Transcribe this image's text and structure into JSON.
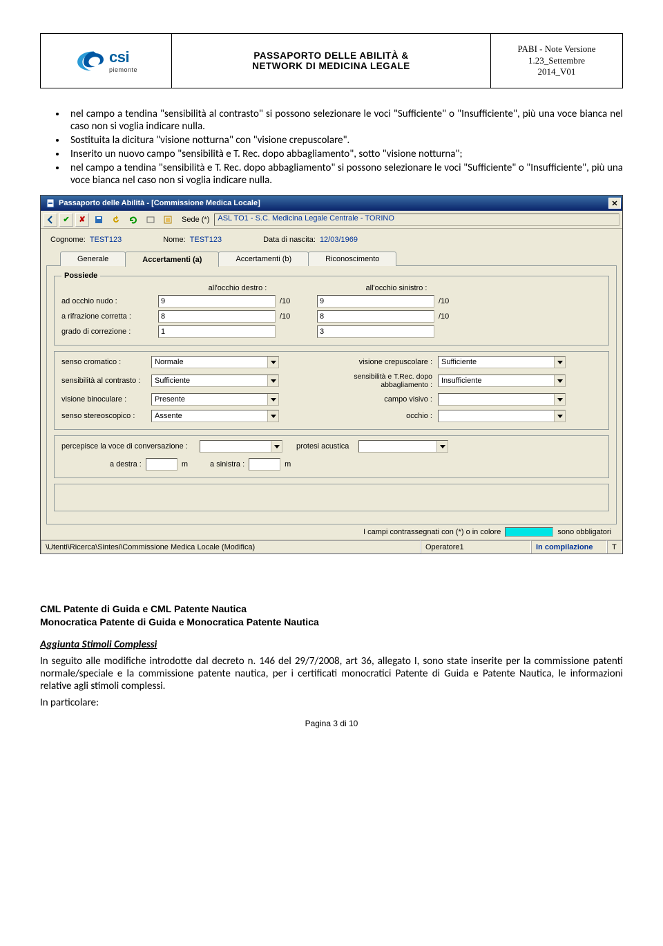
{
  "header": {
    "logo_main": "csi",
    "logo_sub": "piemonte",
    "title_line1": "PASSAPORTO DELLE ABILITÀ &",
    "title_line2": "NETWORK DI MEDICINA LEGALE",
    "meta_line1": "PABI - Note Versione",
    "meta_line2": "1.23_Settembre",
    "meta_line3": "2014_V01"
  },
  "bullets": [
    "nel campo a tendina \"sensibilità al contrasto\" si possono selezionare le voci \"Sufficiente\" o \"Insufficiente\", più una voce bianca nel caso non si voglia indicare nulla.",
    "Sostituita la dicitura \"visione notturna\" con \"visione crepuscolare\".",
    "Inserito un nuovo campo \"sensibilità e T. Rec. dopo abbagliamento\", sotto \"visione notturna\";",
    "nel campo a tendina \"sensibilità e T. Rec. dopo abbagliamento\" si possono selezionare le voci \"Sufficiente\" o \"Insufficiente\", più una voce bianca nel caso non si voglia indicare nulla."
  ],
  "window": {
    "title": "Passaporto delle Abilità - [Commissione Medica Locale]",
    "sede_label": "Sede (*)",
    "sede_value": "ASL TO1 - S.C. Medicina Legale Centrale - TORINO",
    "cognome_label": "Cognome:",
    "cognome_value": "TEST123",
    "nome_label": "Nome:",
    "nome_value": "TEST123",
    "dob_label": "Data di nascita:",
    "dob_value": "12/03/1969",
    "tabs": [
      "Generale",
      "Accertamenti (a)",
      "Accertamenti (b)",
      "Riconoscimento"
    ],
    "possiede_label": "Possiede",
    "col_dx": "all'occhio destro :",
    "col_sx": "all'occhio sinistro :",
    "rows": {
      "nudo_label": "ad occhio nudo :",
      "nudo_dx": "9",
      "nudo_sx": "9",
      "rifr_label": "a rifrazione corretta :",
      "rifr_dx": "8",
      "rifr_sx": "8",
      "grado_label": "grado di correzione :",
      "grado_dx": "1",
      "grado_sx": "3",
      "suffix10": "/10"
    },
    "senso_cromatico_label": "senso cromatico :",
    "senso_cromatico_value": "Normale",
    "sens_contrasto_label": "sensibilità al contrasto :",
    "sens_contrasto_value": "Sufficiente",
    "visione_binoc_label": "visione binoculare :",
    "visione_binoc_value": "Presente",
    "senso_stereo_label": "senso stereoscopico :",
    "senso_stereo_value": "Assente",
    "vis_crep_label": "visione crepuscolare :",
    "vis_crep_value": "Sufficiente",
    "sens_abbag_label": "sensibilità e T.Rec. dopo abbagliamento :",
    "sens_abbag_value": "Insufficiente",
    "campo_visivo_label": "campo visivo :",
    "campo_visivo_value": "",
    "occhio_label": "occhio :",
    "occhio_value": "",
    "perc_voce_label": "percepisce la voce di conversazione :",
    "perc_voce_value": "",
    "protesi_label": "protesi acustica",
    "protesi_value": "",
    "a_destra_label": "a destra :",
    "a_destra_value": "",
    "a_sinistra_label": "a sinistra :",
    "a_sinistra_value": "",
    "m_unit": "m",
    "footer_note_pre": "I campi contrassegnati con (*) o in colore",
    "footer_note_post": "sono obbligatori",
    "status_path": "\\Utenti\\Ricerca\\Sintesi\\Commissione Medica Locale (Modifica)",
    "status_operator": "Operatore1",
    "status_phase": "In compilazione",
    "status_t": "T"
  },
  "section2": {
    "h_line1": "CML Patente di Guida e CML Patente Nautica",
    "h_line2": "Monocratica Patente di Guida e Monocratica Patente Nautica",
    "subhead": "Aggiunta Stimoli Complessi",
    "para1": "In seguito alle modifiche introdotte dal decreto n. 146 del 29/7/2008, art 36, allegato I, sono state inserite per la commissione patenti normale/speciale e la commissione patente nautica, per i certificati monocratici Patente di Guida e Patente Nautica, le informazioni relative agli stimoli complessi.",
    "para2": "In particolare:"
  },
  "page_num": "Pagina 3 di 10"
}
